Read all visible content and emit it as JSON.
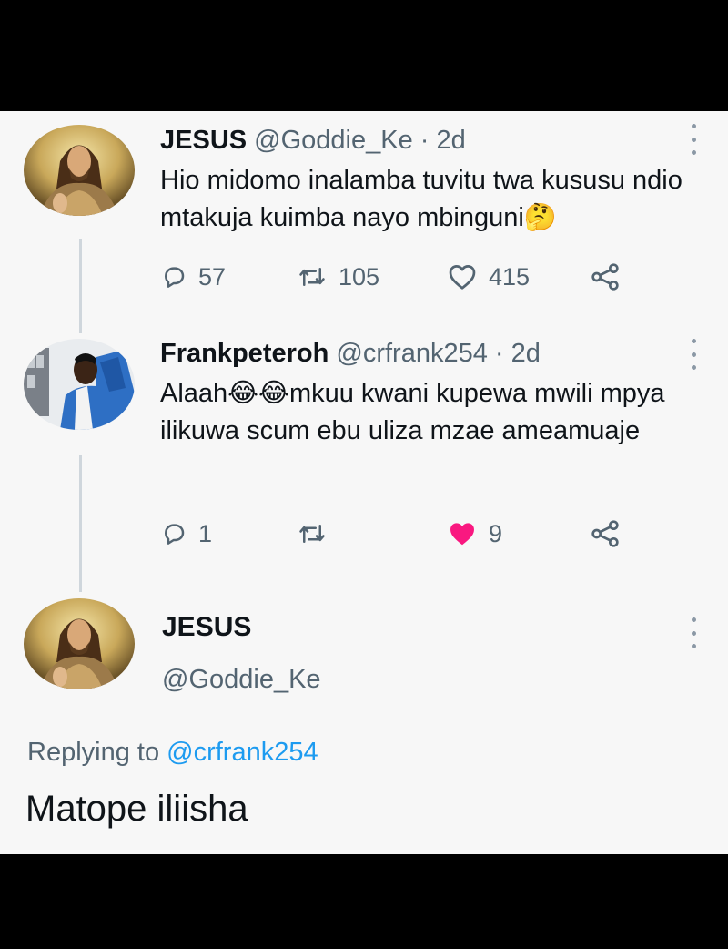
{
  "tweet1": {
    "name": "JESUS",
    "handle": "@Goddie_Ke",
    "time": "· 2d",
    "text": "Hio midomo inalamba tuvitu twa kususu ndio mtakuja kuimba nayo mbinguni🤔",
    "replies": "57",
    "retweets": "105",
    "likes": "415"
  },
  "tweet2": {
    "name": "Frankpeteroh",
    "handle": "@crfrank254",
    "time": "· 2d",
    "text": "Alaah😂😂mkuu kwani kupewa mwili mpya ilikuwa scum ebu uliza mzae ameamuaje",
    "replies": "1",
    "retweets": "",
    "likes": "9"
  },
  "main_tweet": {
    "name": "JESUS",
    "handle": "@Goddie_Ke",
    "replying_prefix": "Replying to",
    "replying_to": "@crfrank254",
    "text": "Matope iliisha"
  },
  "colors": {
    "like_active": "#f91880",
    "link": "#1d9bf0",
    "secondary_text": "#536471"
  },
  "icons": [
    "reply-icon",
    "retweet-icon",
    "like-icon",
    "liked-heart-icon",
    "share-icon",
    "more-options-icon"
  ]
}
